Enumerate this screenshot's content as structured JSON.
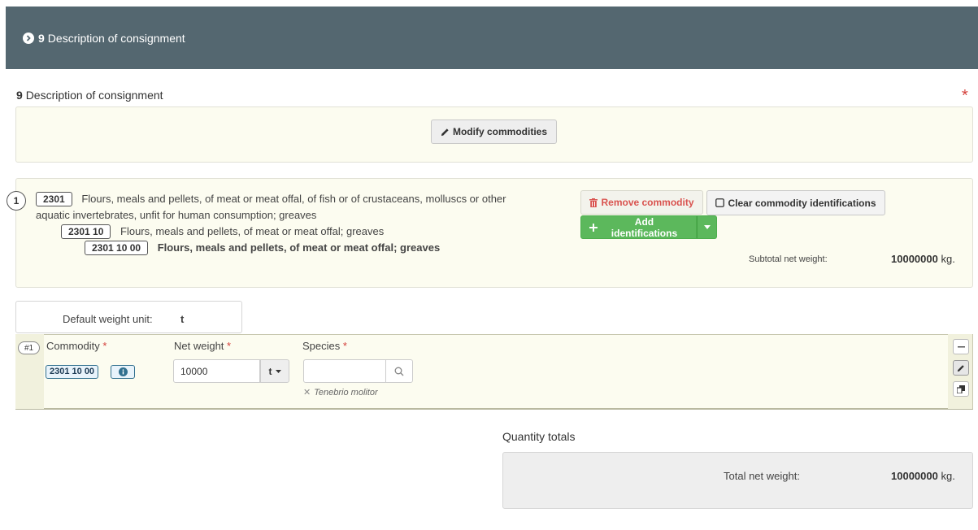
{
  "header": {
    "number": "9",
    "title": "Description of consignment"
  },
  "section": {
    "number": "9",
    "title": "Description of consignment",
    "required_mark": "*"
  },
  "modify_button": {
    "label": "Modify commodities"
  },
  "commodity": {
    "index": "1",
    "level1": {
      "code": "2301",
      "text_a": "Flours, meals and pellets, of meat or meat offal, of fish or of crustaceans, molluscs or other",
      "text_b": "aquatic invertebrates, unfit for human consumption; greaves"
    },
    "level2": {
      "code": "2301 10",
      "text": "Flours, meals and pellets, of meat or meat offal; greaves"
    },
    "level3": {
      "code": "2301 10 00",
      "text": "Flours, meals and pellets, of meat or meat offal; greaves"
    },
    "remove_label": "Remove commodity",
    "clear_label": "Clear commodity identifications",
    "add_label": "Add identifications",
    "subtotal_label": "Subtotal net weight:",
    "subtotal_value": "10000000",
    "subtotal_unit": "kg."
  },
  "default_weight_unit": {
    "label": "Default weight unit:",
    "value": "t"
  },
  "row": {
    "index": "#1",
    "commodity_label": "Commodity",
    "commodity_code": "2301 10 00",
    "net_weight_label": "Net weight",
    "net_weight_value": "10000",
    "net_weight_unit": "t",
    "species_label": "Species",
    "species_value": "",
    "species_selected": "Tenebrio molitor",
    "required_mark": "*"
  },
  "quantity_totals": {
    "title": "Quantity totals",
    "total_label": "Total net weight:",
    "total_value": "10000000",
    "total_unit": "kg."
  },
  "colors": {
    "header_bg": "#546770",
    "required": "#d43f3a",
    "success": "#5cb85c",
    "danger": "#d9534f",
    "panel_bg": "#fcfcf0"
  }
}
